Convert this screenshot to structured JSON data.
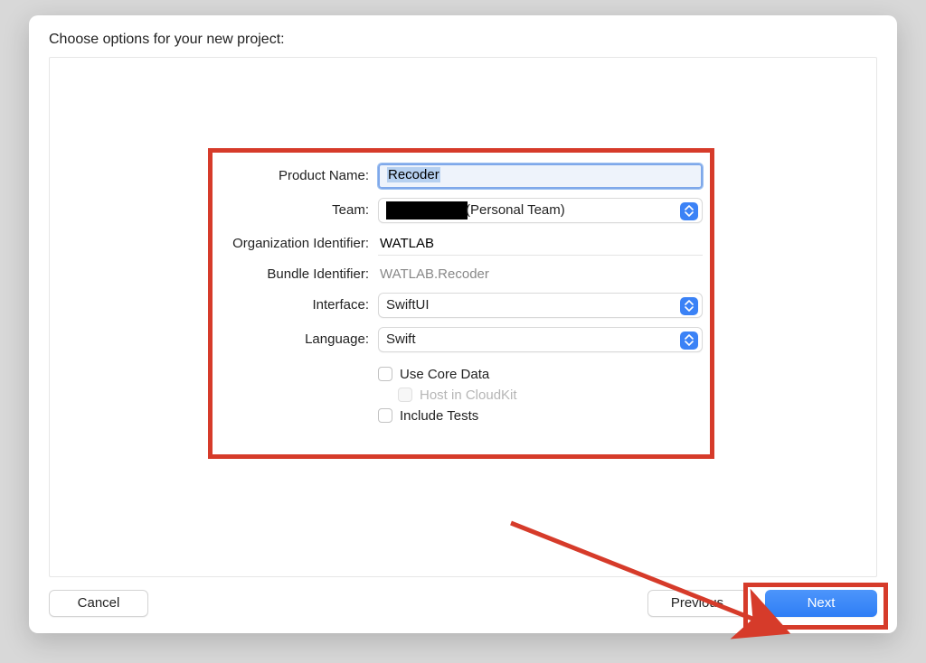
{
  "dialog": {
    "title": "Choose options for your new project:"
  },
  "labels": {
    "product_name": "Product Name:",
    "team": "Team:",
    "org_identifier": "Organization Identifier:",
    "bundle_identifier": "Bundle Identifier:",
    "interface": "Interface:",
    "language": "Language:"
  },
  "values": {
    "product_name": "Recoder",
    "team_suffix": "(Personal Team)",
    "org_identifier": "WATLAB",
    "bundle_identifier": "WATLAB.Recoder",
    "interface": "SwiftUI",
    "language": "Swift"
  },
  "checkboxes": {
    "use_core_data": "Use Core Data",
    "host_cloudkit": "Host in CloudKit",
    "include_tests": "Include Tests"
  },
  "buttons": {
    "cancel": "Cancel",
    "previous": "Previous",
    "next": "Next"
  },
  "annotations": {
    "highlight_color": "#d63b2a"
  }
}
